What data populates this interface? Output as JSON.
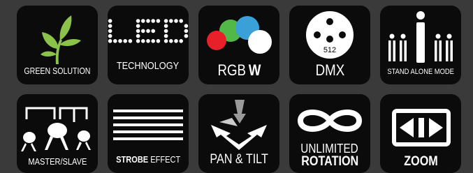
{
  "features": {
    "green_solution": "GREEN SOLUTION",
    "led": "LED",
    "led_technology": "TECHNOLOGY",
    "rgbw_rgb": "RGB",
    "rgbw_w": "W",
    "dmx_pin": "512",
    "dmx": "DMX",
    "stand_alone": "STAND ALONE MODE",
    "master_slave": "MASTER/SLAVE",
    "strobe_bold": "STROBE",
    "strobe_rest": "EFFECT",
    "pan_tilt": "PAN & TILT",
    "unlimited": "UNLIMITED",
    "rotation": "ROTATION",
    "zoom": "ZOOM"
  },
  "colors": {
    "background": "#3a3a3a",
    "tile": "#0b0b0b",
    "leaf_green": "#8bc34a",
    "rgb_red": "#e8202a",
    "rgb_green": "#52b848",
    "rgb_blue": "#3aa0d8",
    "white": "#ffffff"
  },
  "icons": [
    "leaf-icon",
    "led-dots-icon",
    "rgbw-circles-icon",
    "dmx-connector-icon",
    "stand-alone-figures-icon",
    "master-slave-lights-icon",
    "strobe-lines-icon",
    "pan-tilt-arrows-icon",
    "infinity-icon",
    "zoom-arrows-icon"
  ]
}
